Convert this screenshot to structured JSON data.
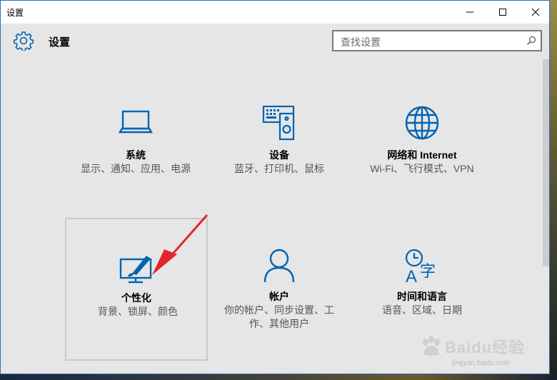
{
  "window": {
    "title": "设置",
    "minimize_label": "minimize",
    "maximize_label": "maximize",
    "close_label": "close"
  },
  "header": {
    "app_title": "设置",
    "icon": "gear-icon"
  },
  "search": {
    "placeholder": "查找设置",
    "icon": "search-icon"
  },
  "tiles": [
    {
      "title": "系统",
      "desc": "显示、通知、应用、电源",
      "icon": "laptop-icon",
      "selected": false
    },
    {
      "title": "设备",
      "desc": "蓝牙、打印机、鼠标",
      "icon": "devices-icon",
      "selected": false
    },
    {
      "title": "网络和 Internet",
      "desc": "Wi-Fi、飞行模式、VPN",
      "icon": "globe-icon",
      "selected": false
    },
    {
      "title": "个性化",
      "desc": "背景、锁屏、颜色",
      "icon": "personalization-icon",
      "selected": true
    },
    {
      "title": "帐户",
      "desc": "你的帐户、同步设置、工作、其他用户",
      "icon": "person-icon",
      "selected": false
    },
    {
      "title": "时间和语言",
      "desc": "语音、区域、日期",
      "icon": "time-language-icon",
      "selected": false
    }
  ],
  "colors": {
    "accent": "#0063b1",
    "annotation_arrow": "#e3262b"
  },
  "watermark": {
    "text": "Baidu经验",
    "url": "jingyan.baidu.com"
  }
}
